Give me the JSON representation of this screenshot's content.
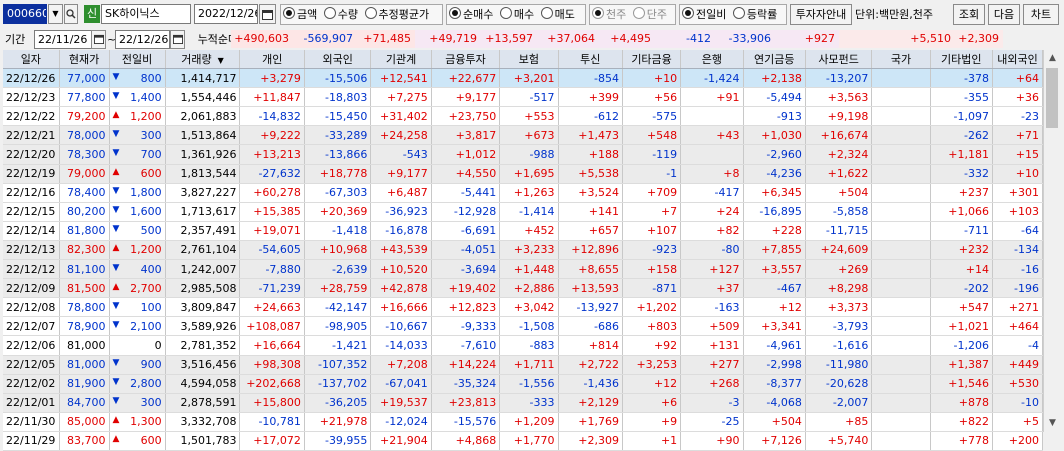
{
  "toolbar": {
    "code": "000660",
    "code_button": "▼",
    "badge": "신",
    "name": "SK하이닉스",
    "date": "2022/12/26",
    "calendar_icon": "calendar-icon",
    "unit_options": [
      "금액",
      "수량",
      "추정평균가"
    ],
    "unit_selected": 0,
    "trade_options": [
      "순매수",
      "매수",
      "매도"
    ],
    "trade_selected": 0,
    "price_options": [
      "천주",
      "단주"
    ],
    "price_selected": 0,
    "compare_options": [
      "전일비",
      "등락률"
    ],
    "compare_selected": 0,
    "investor_button": "투자자안내",
    "unit_label": "단위:백만원,천주",
    "query_button": "조회",
    "next_button": "다음",
    "chart_button": "차트"
  },
  "period": {
    "label": "기간",
    "from": "22/11/26",
    "tilde": "~",
    "to": "22/12/26",
    "cum_label": "누적순매수"
  },
  "summary": [
    {
      "text": "+490,603",
      "dir": "up"
    },
    {
      "text": "-569,907",
      "dir": "dn"
    },
    {
      "text": "+71,485",
      "dir": "up"
    },
    {
      "text": "+49,719",
      "dir": "up"
    },
    {
      "text": "+13,597",
      "dir": "up"
    },
    {
      "text": "+37,064",
      "dir": "up"
    },
    {
      "text": "+4,495",
      "dir": "up"
    },
    {
      "text": "-412",
      "dir": "dn"
    },
    {
      "text": "-33,906",
      "dir": "dn"
    },
    {
      "text": "+927",
      "dir": "up"
    },
    {
      "text": "",
      "dir": "flat"
    },
    {
      "text": "+5,510",
      "dir": "up"
    },
    {
      "text": "+2,309",
      "dir": "up"
    }
  ],
  "headers": [
    "일자",
    "현재가",
    "전일비",
    "거래량",
    "개인",
    "외국인",
    "기관계",
    "금융투자",
    "보험",
    "투신",
    "기타금융",
    "은행",
    "연기금등",
    "사모펀드",
    "국가",
    "기타법인",
    "내외국인"
  ],
  "sort_icon": "▼",
  "rows": [
    [
      "22/12/26",
      "77,000",
      "dn",
      "800",
      "1,414,717",
      "+3,279",
      "-15,506",
      "+12,541",
      "+22,677",
      "+3,201",
      "-854",
      "+10",
      "-1,424",
      "+2,138",
      "-13,207",
      "",
      "-378",
      "+64"
    ],
    [
      "22/12/23",
      "77,800",
      "dn",
      "1,400",
      "1,554,446",
      "+11,847",
      "-18,803",
      "+7,275",
      "+9,177",
      "-517",
      "+399",
      "+56",
      "+91",
      "-5,494",
      "+3,563",
      "",
      "-355",
      "+36"
    ],
    [
      "22/12/22",
      "79,200",
      "up",
      "1,200",
      "2,061,883",
      "-14,832",
      "-15,450",
      "+31,402",
      "+23,750",
      "+553",
      "-612",
      "-575",
      "",
      "-913",
      "+9,198",
      "",
      "-1,097",
      "-23"
    ],
    [
      "22/12/21",
      "78,000",
      "dn",
      "300",
      "1,513,864",
      "+9,222",
      "-33,289",
      "+24,258",
      "+3,817",
      "+673",
      "+1,473",
      "+548",
      "+43",
      "+1,030",
      "+16,674",
      "",
      "-262",
      "+71"
    ],
    [
      "22/12/20",
      "78,300",
      "dn",
      "700",
      "1,361,926",
      "+13,213",
      "-13,866",
      "-543",
      "+1,012",
      "-988",
      "+188",
      "-119",
      "",
      "-2,960",
      "+2,324",
      "",
      "+1,181",
      "+15"
    ],
    [
      "22/12/19",
      "79,000",
      "up",
      "600",
      "1,813,544",
      "-27,632",
      "+18,778",
      "+9,177",
      "+4,550",
      "+1,695",
      "+5,538",
      "-1",
      "+8",
      "-4,236",
      "+1,622",
      "",
      "-332",
      "+10"
    ],
    [
      "22/12/16",
      "78,400",
      "dn",
      "1,800",
      "3,827,227",
      "+60,278",
      "-67,303",
      "+6,487",
      "-5,441",
      "+1,263",
      "+3,524",
      "+709",
      "-417",
      "+6,345",
      "+504",
      "",
      "+237",
      "+301"
    ],
    [
      "22/12/15",
      "80,200",
      "dn",
      "1,600",
      "1,713,617",
      "+15,385",
      "+20,369",
      "-36,923",
      "-12,928",
      "-1,414",
      "+141",
      "+7",
      "+24",
      "-16,895",
      "-5,858",
      "",
      "+1,066",
      "+103"
    ],
    [
      "22/12/14",
      "81,800",
      "dn",
      "500",
      "2,357,491",
      "+19,071",
      "-1,418",
      "-16,878",
      "-6,691",
      "+452",
      "+657",
      "+107",
      "+82",
      "+228",
      "-11,715",
      "",
      "-711",
      "-64"
    ],
    [
      "22/12/13",
      "82,300",
      "up",
      "1,200",
      "2,761,104",
      "-54,605",
      "+10,968",
      "+43,539",
      "-4,051",
      "+3,233",
      "+12,896",
      "-923",
      "-80",
      "+7,855",
      "+24,609",
      "",
      "+232",
      "-134"
    ],
    [
      "22/12/12",
      "81,100",
      "dn",
      "400",
      "1,242,007",
      "-7,880",
      "-2,639",
      "+10,520",
      "-3,694",
      "+1,448",
      "+8,655",
      "+158",
      "+127",
      "+3,557",
      "+269",
      "",
      "+14",
      "-16"
    ],
    [
      "22/12/09",
      "81,500",
      "up",
      "2,700",
      "2,985,508",
      "-71,239",
      "+28,759",
      "+42,878",
      "+19,402",
      "+2,886",
      "+13,593",
      "-871",
      "+37",
      "-467",
      "+8,298",
      "",
      "-202",
      "-196"
    ],
    [
      "22/12/08",
      "78,800",
      "dn",
      "100",
      "3,809,847",
      "+24,663",
      "-42,147",
      "+16,666",
      "+12,823",
      "+3,042",
      "-13,927",
      "+1,202",
      "-163",
      "+12",
      "+3,373",
      "",
      "+547",
      "+271"
    ],
    [
      "22/12/07",
      "78,900",
      "dn",
      "2,100",
      "3,589,926",
      "+108,087",
      "-98,905",
      "-10,667",
      "-9,333",
      "-1,508",
      "-686",
      "+803",
      "+509",
      "+3,341",
      "-3,793",
      "",
      "+1,021",
      "+464"
    ],
    [
      "22/12/06",
      "81,000",
      "flat",
      "0",
      "2,781,352",
      "+16,664",
      "-1,421",
      "-14,033",
      "-7,610",
      "-883",
      "+814",
      "+92",
      "+131",
      "-4,961",
      "-1,616",
      "",
      "-1,206",
      "-4"
    ],
    [
      "22/12/05",
      "81,000",
      "dn",
      "900",
      "3,516,456",
      "+98,308",
      "-107,352",
      "+7,208",
      "+14,224",
      "+1,711",
      "+2,722",
      "+3,253",
      "+277",
      "-2,998",
      "-11,980",
      "",
      "+1,387",
      "+449"
    ],
    [
      "22/12/02",
      "81,900",
      "dn",
      "2,800",
      "4,594,058",
      "+202,668",
      "-137,702",
      "-67,041",
      "-35,324",
      "-1,556",
      "-1,436",
      "+12",
      "+268",
      "-8,377",
      "-20,628",
      "",
      "+1,546",
      "+530"
    ],
    [
      "22/12/01",
      "84,700",
      "dn",
      "300",
      "2,878,591",
      "+15,800",
      "-36,205",
      "+19,537",
      "+23,813",
      "-333",
      "+2,129",
      "+6",
      "-3",
      "-4,068",
      "-2,007",
      "",
      "+878",
      "-10"
    ],
    [
      "22/11/30",
      "85,000",
      "up",
      "1,300",
      "3,332,708",
      "-10,781",
      "+21,978",
      "-12,024",
      "-15,576",
      "+1,209",
      "+1,769",
      "+9",
      "-25",
      "+504",
      "+85",
      "",
      "+822",
      "+5"
    ],
    [
      "22/11/29",
      "83,700",
      "up",
      "600",
      "1,501,783",
      "+17,072",
      "-39,955",
      "+21,904",
      "+4,868",
      "+1,770",
      "+2,309",
      "+1",
      "+90",
      "+7,126",
      "+5,740",
      "",
      "+778",
      "+200"
    ]
  ],
  "colors": {
    "up": "#e00000",
    "down": "#0033cc",
    "header_bg": "#dde4ee",
    "selected_row": "#cde6f7",
    "alt_row": "#ebebeb"
  },
  "scroll": {
    "up_icon": "scroll-up-icon",
    "down_icon": "scroll-down-icon"
  }
}
